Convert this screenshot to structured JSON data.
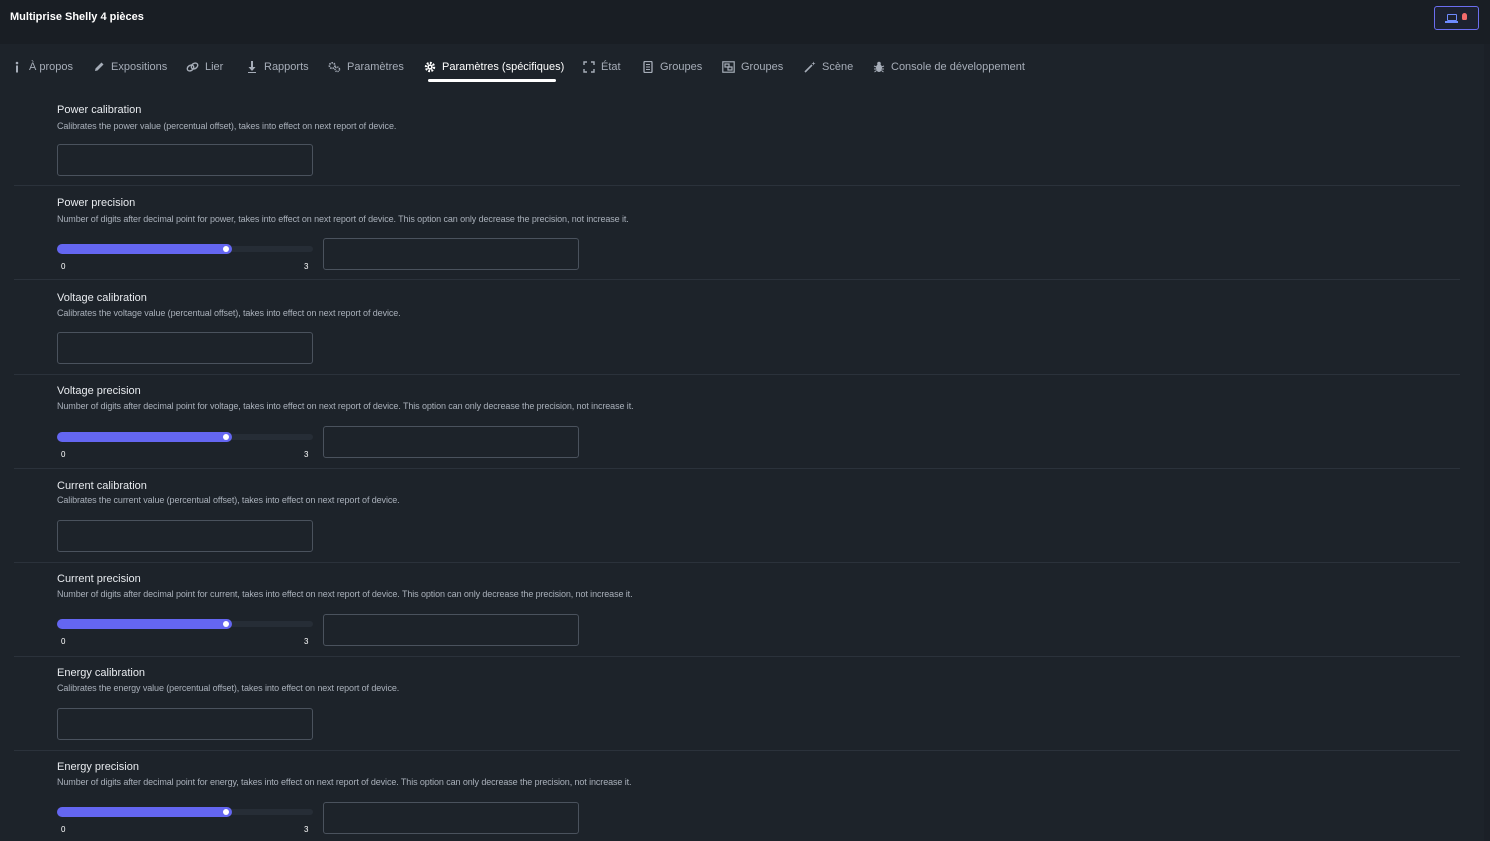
{
  "window": {
    "title": "Multiprise Shelly 4 pièces",
    "permit_join_icon": "device-icon",
    "status_dot_color": "#f26b6b"
  },
  "tabs": [
    {
      "label": "À propos",
      "icon": "info-icon"
    },
    {
      "label": "Expositions",
      "icon": "pencil-icon"
    },
    {
      "label": "Lier",
      "icon": "link-icon"
    },
    {
      "label": "Rapports",
      "icon": "download-icon"
    },
    {
      "label": "Paramètres",
      "icon": "gears-icon"
    },
    {
      "label": "Paramètres (spécifiques)",
      "icon": "gear-icon",
      "active": true
    },
    {
      "label": "État",
      "icon": "expand-icon"
    },
    {
      "label": "Groupes",
      "icon": "document-icon"
    },
    {
      "label": "Groupes",
      "icon": "object-group-icon"
    },
    {
      "label": "Scène",
      "icon": "magic-wand-icon"
    },
    {
      "label": "Console de développement",
      "icon": "bug-icon"
    }
  ],
  "accent_color": "#6466f1",
  "settings": [
    {
      "label": "Power calibration",
      "description": "Calibrates the power value (percentual offset), takes into effect on next report of device.",
      "type": "number",
      "value": ""
    },
    {
      "label": "Power precision",
      "description": "Number of digits after decimal point for power, takes into effect on next report of device. This option can only decrease the precision, not increase it.",
      "type": "slider",
      "min": "0",
      "max": "3",
      "slider_fraction": 0.68,
      "value": ""
    },
    {
      "label": "Voltage calibration",
      "description": "Calibrates the voltage value (percentual offset), takes into effect on next report of device.",
      "type": "number",
      "value": ""
    },
    {
      "label": "Voltage precision",
      "description": "Number of digits after decimal point for voltage, takes into effect on next report of device. This option can only decrease the precision, not increase it.",
      "type": "slider",
      "min": "0",
      "max": "3",
      "slider_fraction": 0.68,
      "value": ""
    },
    {
      "label": "Current calibration",
      "description": "Calibrates the current value (percentual offset), takes into effect on next report of device.",
      "type": "number",
      "value": ""
    },
    {
      "label": "Current precision",
      "description": "Number of digits after decimal point for current, takes into effect on next report of device. This option can only decrease the precision, not increase it.",
      "type": "slider",
      "min": "0",
      "max": "3",
      "slider_fraction": 0.68,
      "value": ""
    },
    {
      "label": "Energy calibration",
      "description": "Calibrates the energy value (percentual offset), takes into effect on next report of device.",
      "type": "number",
      "value": ""
    },
    {
      "label": "Energy precision",
      "description": "Number of digits after decimal point for energy, takes into effect on next report of device. This option can only decrease the precision, not increase it.",
      "type": "slider",
      "min": "0",
      "max": "3",
      "slider_fraction": 0.68,
      "value": ""
    }
  ]
}
